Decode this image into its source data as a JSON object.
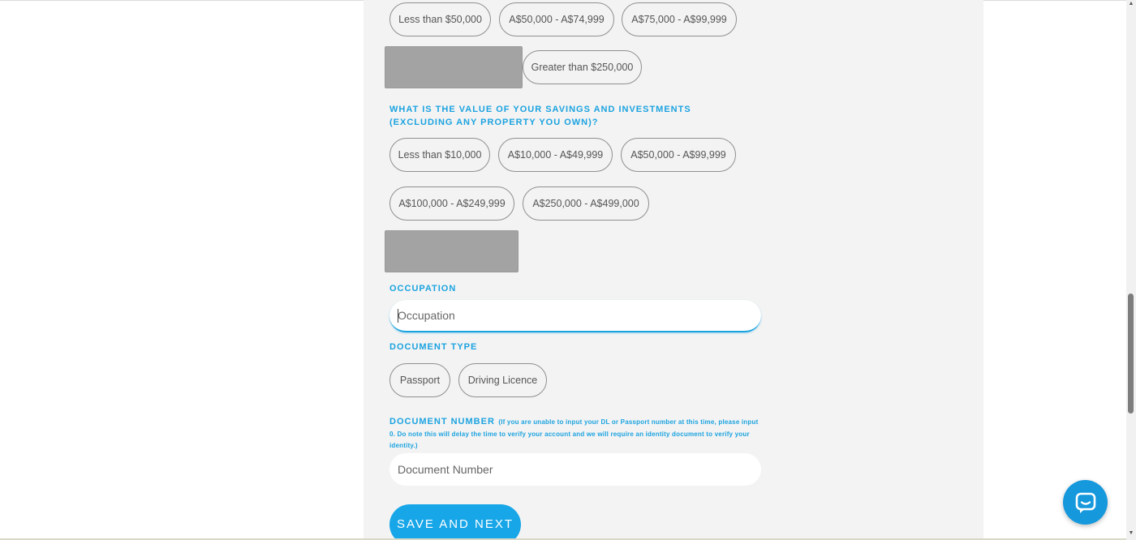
{
  "income_options": {
    "row1": [
      "Less than $50,000",
      "A$50,000 - A$74,999",
      "A$75,000 - A$99,999"
    ],
    "row2_visible": "Greater than $250,000"
  },
  "savings": {
    "question": "WHAT IS THE VALUE OF YOUR SAVINGS AND INVESTMENTS (EXCLUDING ANY PROPERTY YOU OWN)?",
    "options": [
      "Less than $10,000",
      "A$10,000 - A$49,999",
      "A$50,000 - A$99,999",
      "A$100,000 - A$249,999",
      "A$250,000 - A$499,000"
    ]
  },
  "occupation": {
    "label": "OCCUPATION",
    "placeholder": "Occupation"
  },
  "document_type": {
    "label": "DOCUMENT TYPE",
    "options": [
      "Passport",
      "Driving Licence"
    ]
  },
  "document_number": {
    "label": "DOCUMENT NUMBER",
    "note": "(If you are unable to input your DL or Passport number at this time, please input 0. Do note this will delay the time to verify your account and we will require an identity document to verify your identity.)",
    "placeholder": "Document Number"
  },
  "actions": {
    "save_next_label": "SAVE AND NEXT"
  },
  "colors": {
    "accent": "#1ba3e0",
    "button": "#17a6e8",
    "chat": "#1598dc",
    "panel": "#f3f3f3",
    "redacted": "#a3a3a3"
  },
  "icons": {
    "chat": "chat-bubble-icon",
    "scroll_up": "scroll-up-arrow-icon",
    "scroll_down": "scroll-down-arrow-icon"
  }
}
